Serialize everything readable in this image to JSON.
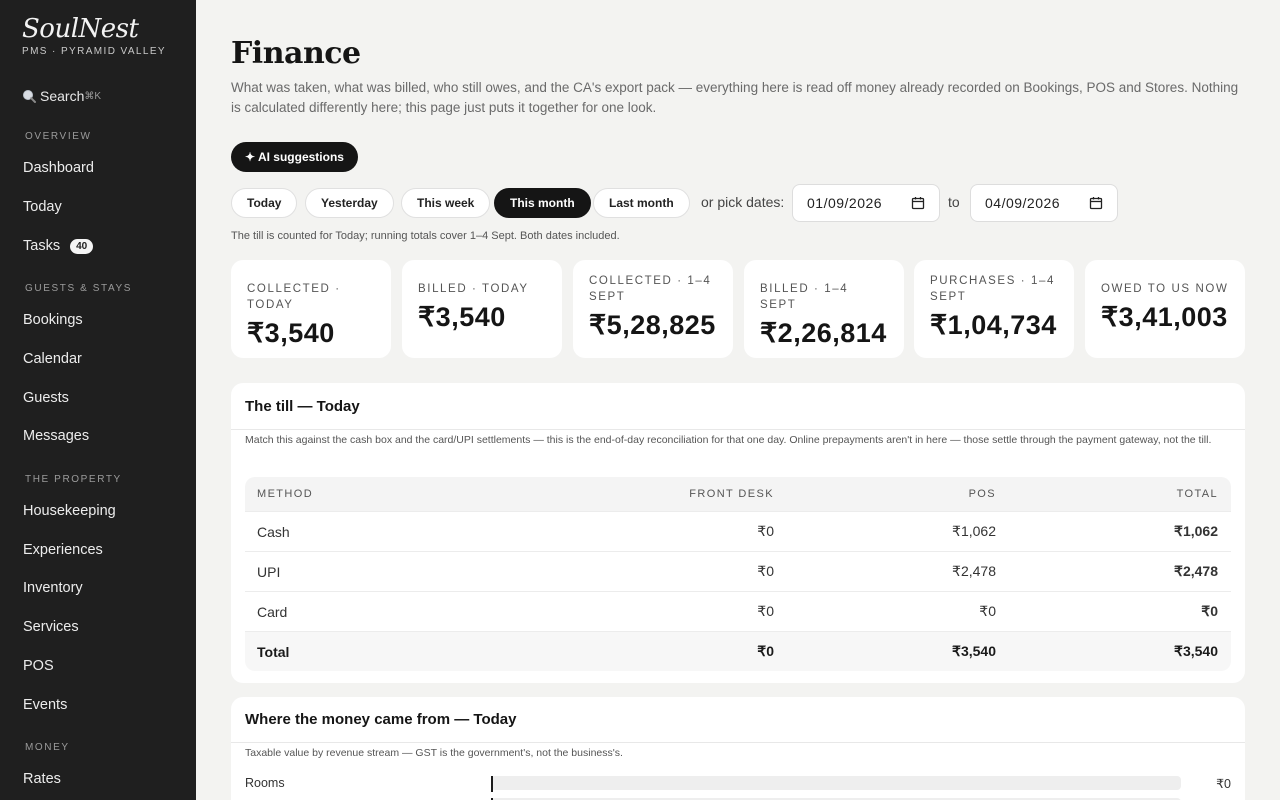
{
  "sidebar": {
    "brand": "SoulNest",
    "brand_sub": "PMS · PYRAMID VALLEY",
    "search_label": "Search",
    "search_shortcut": "⌘K",
    "sections": {
      "overview": "OVERVIEW",
      "guests_stays": "GUESTS & STAYS",
      "the_property": "THE PROPERTY",
      "money": "MONEY"
    },
    "items": {
      "dashboard": "Dashboard",
      "today": "Today",
      "tasks": "Tasks",
      "tasks_badge": "40",
      "bookings": "Bookings",
      "calendar": "Calendar",
      "guests": "Guests",
      "messages": "Messages",
      "housekeeping": "Housekeeping",
      "experiences": "Experiences",
      "inventory": "Inventory",
      "services": "Services",
      "pos": "POS",
      "events": "Events",
      "rates": "Rates"
    },
    "icons": {
      "search": "search-icon"
    }
  },
  "header": {
    "title": "Finance",
    "description": "What was taken, what was billed, who still owes, and the CA's export pack — everything here is read off money already recorded on Bookings, POS and Stores. Nothing is calculated differently here; this page just puts it together for one look.",
    "ai_button": "✦ AI suggestions"
  },
  "range": {
    "buttons": {
      "today": "Today",
      "yesterday": "Yesterday",
      "this_week": "This week",
      "this_month": "This month",
      "last_month": "Last month"
    },
    "active": "This month",
    "pick_label": "or pick dates:",
    "from_date": "01/09/2026",
    "to_label": "to",
    "to_date": "04/09/2026",
    "note": "The till is counted for Today; running totals cover 1–4 Sept. Both dates included."
  },
  "stats": [
    {
      "label": "COLLECTED · TODAY",
      "value": "₹3,540"
    },
    {
      "label": "BILLED · TODAY",
      "value": "₹3,540"
    },
    {
      "label": "COLLECTED · 1–4 SEPT",
      "value": "₹5,28,825"
    },
    {
      "label": "BILLED · 1–4 SEPT",
      "value": "₹2,26,814"
    },
    {
      "label": "PURCHASES · 1–4 SEPT",
      "value": "₹1,04,734"
    },
    {
      "label": "OWED TO US NOW",
      "value": "₹3,41,003"
    }
  ],
  "till": {
    "title": "The till — Today",
    "note": "Match this against the cash box and the card/UPI settlements — this is the end-of-day reconciliation for that one day. Online prepayments aren't in here — those settle through the payment gateway, not the till.",
    "columns": {
      "method": "METHOD",
      "front_desk": "FRONT DESK",
      "pos": "POS",
      "total": "TOTAL"
    },
    "rows": [
      {
        "method": "Cash",
        "front_desk": "₹0",
        "pos": "₹1,062",
        "total": "₹1,062"
      },
      {
        "method": "UPI",
        "front_desk": "₹0",
        "pos": "₹2,478",
        "total": "₹2,478"
      },
      {
        "method": "Card",
        "front_desk": "₹0",
        "pos": "₹0",
        "total": "₹0"
      }
    ],
    "total_row": {
      "method": "Total",
      "front_desk": "₹0",
      "pos": "₹3,540",
      "total": "₹3,540"
    }
  },
  "sources": {
    "title": "Where the money came from — Today",
    "note": "Taxable value by revenue stream — GST is the government's, not the business's.",
    "rows": [
      {
        "label": "Rooms",
        "value": "₹0",
        "share": 0
      }
    ]
  },
  "colors": {
    "accent": "#151515",
    "sidebar_bg": "#1f1f1f",
    "page_bg": "#f3f3f1"
  }
}
